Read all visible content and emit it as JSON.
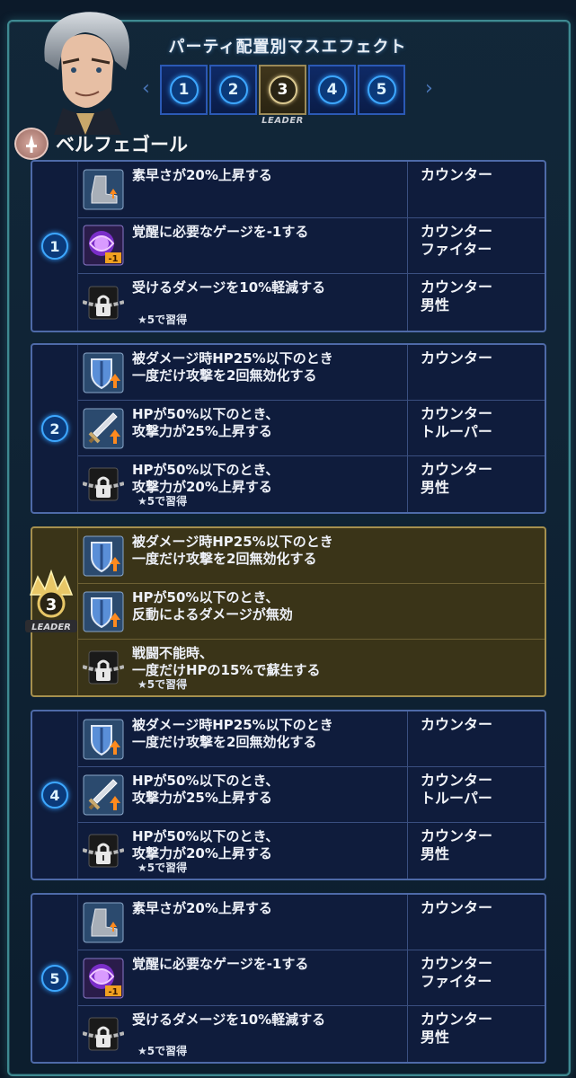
{
  "header": {
    "title": "パーティ配置別マスエフェクト",
    "slots": [
      "1",
      "2",
      "3",
      "4",
      "5"
    ],
    "selected_slot": "3",
    "leader_label": "LEADER"
  },
  "character": {
    "name": "ベルフェゴール"
  },
  "groups": [
    {
      "num": "1",
      "leader": false,
      "rows": [
        {
          "icon": "boot-up-icon",
          "text": [
            "素早さが20%上昇する"
          ],
          "tags": [
            "カウンター"
          ],
          "lock": ""
        },
        {
          "icon": "purple-orb-minus-one-icon",
          "text": [
            "覚醒に必要なゲージを-1する"
          ],
          "tags": [
            "カウンター",
            "ファイター"
          ],
          "lock": ""
        },
        {
          "icon": "chained-lock-icon",
          "text": [
            "受けるダメージを10%軽減する"
          ],
          "tags": [
            "カウンター",
            "男性"
          ],
          "lock": "★5で習得"
        }
      ]
    },
    {
      "num": "2",
      "leader": false,
      "rows": [
        {
          "icon": "shield-up-icon",
          "text": [
            "被ダメージ時HP25%以下のとき",
            "一度だけ攻撃を2回無効化する"
          ],
          "tags": [
            "カウンター"
          ],
          "lock": ""
        },
        {
          "icon": "sword-up-icon",
          "text": [
            "HPが50%以下のとき、",
            "攻撃力が25%上昇する"
          ],
          "tags": [
            "カウンター",
            "トルーパー"
          ],
          "lock": ""
        },
        {
          "icon": "chained-lock-icon",
          "text": [
            "HPが50%以下のとき、",
            "攻撃力が20%上昇する"
          ],
          "tags": [
            "カウンター",
            "男性"
          ],
          "lock": "★5で習得"
        }
      ]
    },
    {
      "num": "3",
      "leader": true,
      "rows": [
        {
          "icon": "shield-up-icon",
          "text": [
            "被ダメージ時HP25%以下のとき",
            "一度だけ攻撃を2回無効化する"
          ],
          "tags": [],
          "lock": ""
        },
        {
          "icon": "shield-up-icon",
          "text": [
            "HPが50%以下のとき、",
            "反動によるダメージが無効"
          ],
          "tags": [],
          "lock": ""
        },
        {
          "icon": "chained-lock-icon",
          "text": [
            "戦闘不能時、",
            "一度だけHPの15%で蘇生する"
          ],
          "tags": [],
          "lock": "★5で習得"
        }
      ]
    },
    {
      "num": "4",
      "leader": false,
      "rows": [
        {
          "icon": "shield-up-icon",
          "text": [
            "被ダメージ時HP25%以下のとき",
            "一度だけ攻撃を2回無効化する"
          ],
          "tags": [
            "カウンター"
          ],
          "lock": ""
        },
        {
          "icon": "sword-up-icon",
          "text": [
            "HPが50%以下のとき、",
            "攻撃力が25%上昇する"
          ],
          "tags": [
            "カウンター",
            "トルーパー"
          ],
          "lock": ""
        },
        {
          "icon": "chained-lock-icon",
          "text": [
            "HPが50%以下のとき、",
            "攻撃力が20%上昇する"
          ],
          "tags": [
            "カウンター",
            "男性"
          ],
          "lock": "★5で習得"
        }
      ]
    },
    {
      "num": "5",
      "leader": false,
      "rows": [
        {
          "icon": "boot-up-icon",
          "text": [
            "素早さが20%上昇する"
          ],
          "tags": [
            "カウンター"
          ],
          "lock": ""
        },
        {
          "icon": "purple-orb-minus-one-icon",
          "text": [
            "覚醒に必要なゲージを-1する"
          ],
          "tags": [
            "カウンター",
            "ファイター"
          ],
          "lock": ""
        },
        {
          "icon": "chained-lock-icon",
          "text": [
            "受けるダメージを10%軽減する"
          ],
          "tags": [
            "カウンター",
            "男性"
          ],
          "lock": "★5で習得"
        }
      ]
    }
  ],
  "crown_label": "LEADER"
}
